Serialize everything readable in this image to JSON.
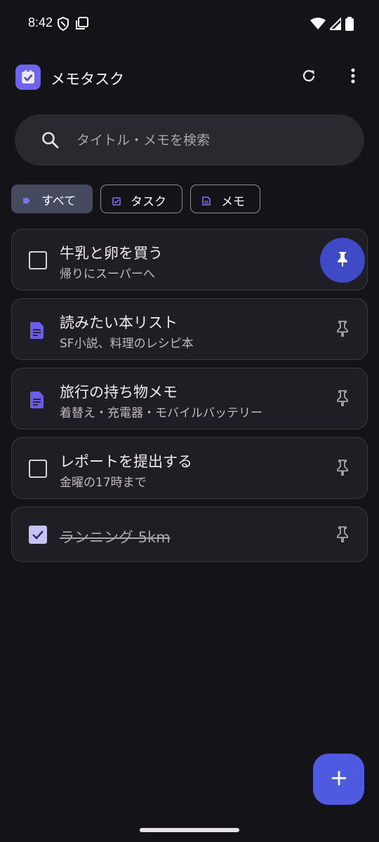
{
  "status_bar": {
    "time": "8:42",
    "left_icons": [
      "shield-icon",
      "screenshot-icon"
    ],
    "right_icons": [
      "wifi-icon",
      "signal-icon",
      "battery-icon"
    ]
  },
  "app_bar": {
    "title": "メモタスク",
    "logo_icon": "app-logo-icon",
    "accent_color": "#6f63f0",
    "actions": [
      "refresh-icon",
      "more-vert-icon"
    ]
  },
  "search": {
    "placeholder": "タイトル・メモを検索",
    "value": ""
  },
  "filters": [
    {
      "label": "すべて",
      "icon": "all-icon",
      "selected": true
    },
    {
      "label": "タスク",
      "icon": "task-icon",
      "selected": false
    },
    {
      "label": "メモ",
      "icon": "memo-icon",
      "selected": false
    }
  ],
  "items": [
    {
      "type": "task",
      "title": "牛乳と卵を買う",
      "subtitle": "帰りにスーパーへ",
      "checked": false,
      "pinned": true
    },
    {
      "type": "memo",
      "title": "読みたい本リスト",
      "subtitle": "SF小説、料理のレシピ本",
      "pinned": false
    },
    {
      "type": "memo",
      "title": "旅行の持ち物メモ",
      "subtitle": "着替え・充電器・モバイルバッテリー",
      "pinned": false
    },
    {
      "type": "task",
      "title": "レポートを提出する",
      "subtitle": "金曜の17時まで",
      "checked": false,
      "pinned": false
    },
    {
      "type": "task",
      "title": "ランニング 5km",
      "subtitle": "",
      "checked": true,
      "pinned": false
    }
  ],
  "fab": {
    "icon": "plus-icon",
    "color": "#4e5ae0"
  },
  "colors": {
    "background": "#141318",
    "card": "#1f1e24",
    "pin_active": "#3f4ac6",
    "memo_icon": "#6f63f0"
  }
}
